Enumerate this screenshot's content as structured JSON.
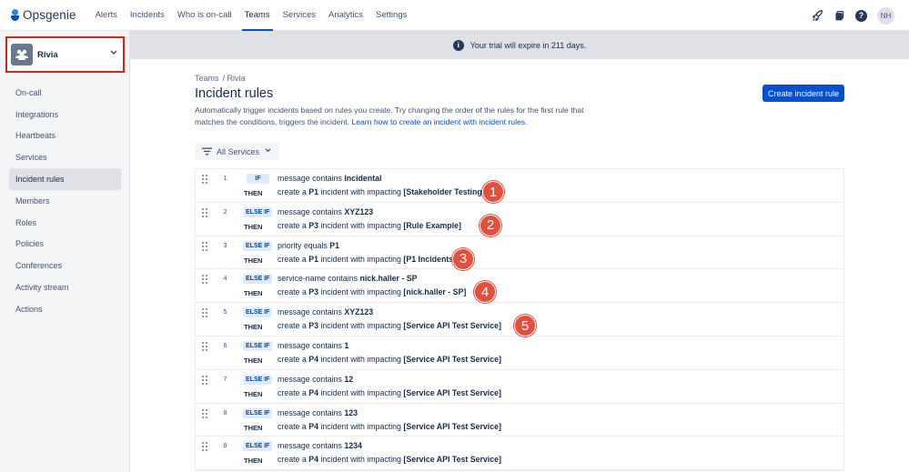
{
  "app": {
    "name": "Opsgenie"
  },
  "nav": {
    "items": [
      "Alerts",
      "Incidents",
      "Who is on-call",
      "Teams",
      "Services",
      "Analytics",
      "Settings"
    ],
    "active": "Teams",
    "user_initials": "NH"
  },
  "sidebar": {
    "team_name": "Rivia",
    "items": [
      "On-call",
      "Integrations",
      "Heartbeats",
      "Services",
      "Incident rules",
      "Members",
      "Roles",
      "Policies",
      "Conferences",
      "Activity stream",
      "Actions"
    ],
    "active": "Incident rules"
  },
  "banner": {
    "text": "Your trial will expire in 211 days."
  },
  "breadcrumb": {
    "root": "Teams",
    "current": "/ Rivia"
  },
  "page": {
    "title": "Incident rules",
    "description": "Automatically trigger incidents based on rules you create. Try changing the order of the rules for the first rule that matches the conditions, triggers the incident.",
    "learn_link": "Learn how to create an incident with incident rules.",
    "create_button": "Create incident rule"
  },
  "filter": {
    "label": "All Services"
  },
  "labels": {
    "then": "THEN"
  },
  "rules": [
    {
      "num": "1",
      "tag": "IF",
      "cond_prefix": "message contains ",
      "cond_value": "Incidental",
      "action_prefix": "create a ",
      "priority": "P1",
      "action_mid": " incident with impacting ",
      "service": "[Stakeholder Testing]",
      "marker": "1"
    },
    {
      "num": "2",
      "tag": "ELSE IF",
      "cond_prefix": "message contains ",
      "cond_value": "XYZ123",
      "action_prefix": "create a ",
      "priority": "P3",
      "action_mid": " incident with impacting ",
      "service": "[Rule Example]",
      "marker": "2"
    },
    {
      "num": "3",
      "tag": "ELSE IF",
      "cond_prefix": "priority equals ",
      "cond_value": "P1",
      "action_prefix": "create a ",
      "priority": "P1",
      "action_mid": " incident with impacting ",
      "service": "[P1 Incidents]",
      "marker": "3"
    },
    {
      "num": "4",
      "tag": "ELSE IF",
      "cond_prefix": "service-name contains ",
      "cond_value": "nick.haller - SP",
      "action_prefix": "create a ",
      "priority": "P3",
      "action_mid": " incident with impacting ",
      "service": "[nick.haller - SP]",
      "marker": "4"
    },
    {
      "num": "5",
      "tag": "ELSE IF",
      "cond_prefix": "message contains ",
      "cond_value": "XYZ123",
      "action_prefix": "create a ",
      "priority": "P3",
      "action_mid": " incident with impacting ",
      "service": "[Service API Test Service]",
      "marker": "5"
    },
    {
      "num": "6",
      "tag": "ELSE IF",
      "cond_prefix": "message contains ",
      "cond_value": "1",
      "action_prefix": "create a ",
      "priority": "P4",
      "action_mid": " incident with impacting ",
      "service": "[Service API Test Service]"
    },
    {
      "num": "7",
      "tag": "ELSE IF",
      "cond_prefix": "message contains ",
      "cond_value": "12",
      "action_prefix": "create a ",
      "priority": "P4",
      "action_mid": " incident with impacting ",
      "service": "[Service API Test Service]"
    },
    {
      "num": "8",
      "tag": "ELSE IF",
      "cond_prefix": "message contains ",
      "cond_value": "123",
      "action_prefix": "create a ",
      "priority": "P4",
      "action_mid": " incident with impacting ",
      "service": "[Service API Test Service]"
    },
    {
      "num": "9",
      "tag": "ELSE IF",
      "cond_prefix": "message contains ",
      "cond_value": "1234",
      "action_prefix": "create a ",
      "priority": "P4",
      "action_mid": " incident with impacting ",
      "service": "[Service API Test Service]"
    }
  ],
  "icons": {
    "rocket": "rocket-icon",
    "dashboard": "statuspage-icon",
    "help": "help-icon",
    "info": "info-icon",
    "team": "team-icon",
    "filter": "filter-icon",
    "drag": "drag-handle-icon"
  },
  "colors": {
    "primary": "#0052cc",
    "marker": "#e0503f",
    "highlight_border": "#d0271d"
  }
}
